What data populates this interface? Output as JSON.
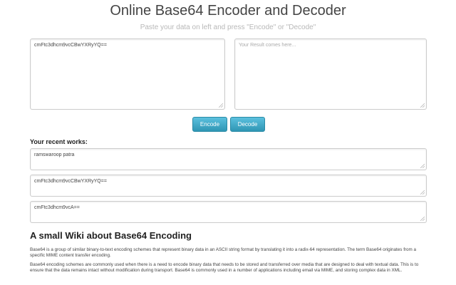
{
  "header": {
    "title": "Online Base64 Encoder and Decoder",
    "subtitle": "Paste your data on left and press \"Encode\" or \"Decode\""
  },
  "editor": {
    "input_value": "cmFtc3dhcm9vcCBwYXRyYQ==",
    "output_placeholder": "Your Result comes here..."
  },
  "buttons": {
    "encode_label": "Encode",
    "decode_label": "Decode"
  },
  "recent": {
    "heading": "Your recent works:",
    "items": [
      "ramswaroop patra",
      "cmFtc3dhcm9vcCBwYXRyYQ==",
      "cmFtc3dhcm9vcA=="
    ]
  },
  "wiki": {
    "heading": "A small Wiki about Base64 Encoding",
    "paragraphs": [
      "Base64 is a group of similar binary-to-text encoding schemes that represent binary data in an ASCII string format by translating it into a radix-64 representation. The term Base64 originates from a specific MIME content transfer encoding.",
      "Base64 encoding schemes are commonly used when there is a need to encode binary data that needs to be stored and transferred over media that are designed to deal with textual data. This is to ensure that the data remains intact without modification during transport. Base64 is commonly used in a number of applications including email via MIME, and storing complex data in XML."
    ]
  },
  "colors": {
    "button_blue": "#49afcd",
    "border": "#cccccc"
  }
}
